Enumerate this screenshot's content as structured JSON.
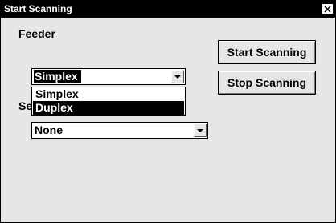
{
  "window": {
    "title": "Start Scanning"
  },
  "feeder": {
    "label": "Feeder",
    "value": "Simplex",
    "options": [
      "Simplex",
      "Duplex"
    ],
    "highlighted": "Duplex"
  },
  "second": {
    "label_visible": "Se",
    "value": "None"
  },
  "buttons": {
    "start": "Start Scanning",
    "stop": "Stop Scanning"
  }
}
